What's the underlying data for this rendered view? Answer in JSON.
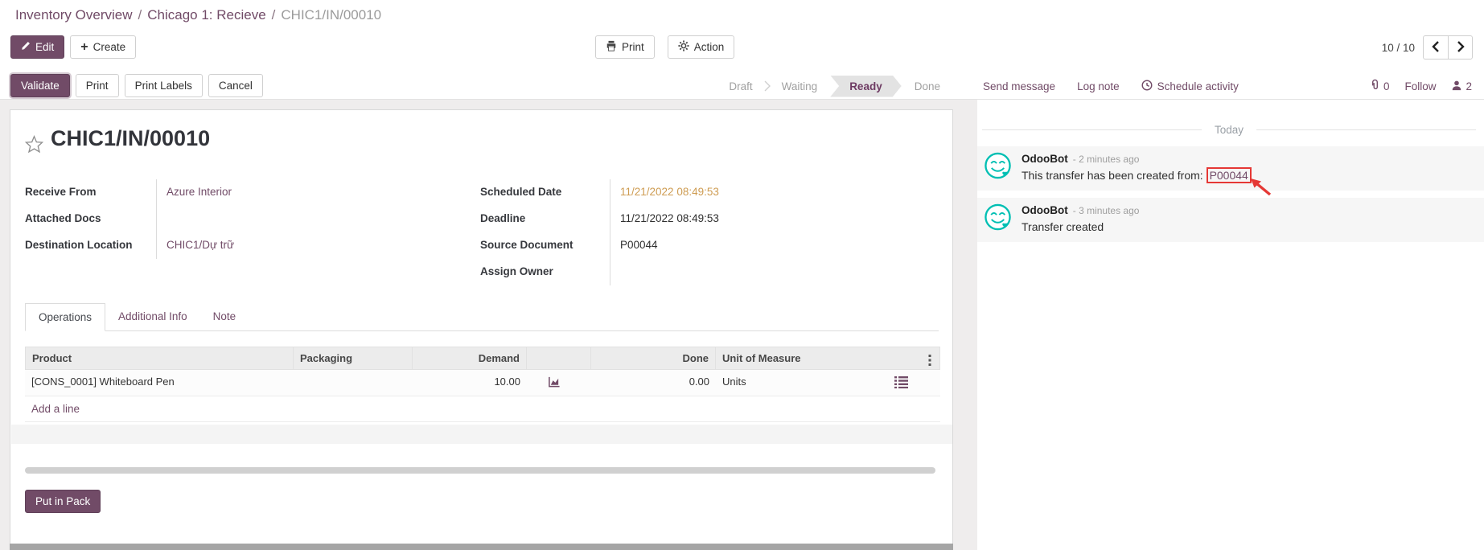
{
  "breadcrumb": {
    "part1": "Inventory Overview",
    "sep1": "/",
    "part2": "Chicago 1: Recieve",
    "sep2": "/",
    "part3": "CHIC1/IN/00010"
  },
  "control_panel": {
    "edit_label": "Edit",
    "create_label": "Create",
    "print_label": "Print",
    "action_label": "Action",
    "pager_counter": "10 / 10"
  },
  "statusbar": {
    "validate_label": "Validate",
    "print_label": "Print",
    "print_labels_label": "Print Labels",
    "cancel_label": "Cancel",
    "steps": {
      "draft": "Draft",
      "waiting": "Waiting",
      "ready": "Ready",
      "done": "Done"
    },
    "active_step": "Ready"
  },
  "chatter": {
    "send_message_label": "Send message",
    "log_note_label": "Log note",
    "schedule_activity_label": "Schedule activity",
    "attachment_count": "0",
    "follow_label": "Follow",
    "follower_count": "2",
    "date_divider": "Today",
    "messages": [
      {
        "author": "OdooBot",
        "time": "- 2 minutes ago",
        "body_prefix": "This transfer has been created from: ",
        "body_link": "P00044"
      },
      {
        "author": "OdooBot",
        "time": "- 3 minutes ago",
        "body": "Transfer created"
      }
    ]
  },
  "sheet": {
    "title": "CHIC1/IN/00010",
    "fields_left": [
      {
        "label": "Receive From",
        "value": "Azure Interior"
      },
      {
        "label": "Attached Docs",
        "value": ""
      },
      {
        "label": "Destination Location",
        "value": "CHIC1/Dự trữ"
      }
    ],
    "fields_right": [
      {
        "label": "Scheduled Date",
        "value": "11/21/2022 08:49:53"
      },
      {
        "label": "Deadline",
        "value": "11/21/2022 08:49:53"
      },
      {
        "label": "Source Document",
        "value": "P00044"
      },
      {
        "label": "Assign Owner",
        "value": ""
      }
    ],
    "tabs": {
      "operations": "Operations",
      "additional_info": "Additional Info",
      "note": "Note"
    },
    "active_tab": "Operations",
    "table": {
      "headers": {
        "product": "Product",
        "packaging": "Packaging",
        "demand": "Demand",
        "done": "Done",
        "uom": "Unit of Measure"
      },
      "rows": [
        {
          "product": "[CONS_0001] Whiteboard Pen",
          "packaging": "",
          "demand": "10.00",
          "done": "0.00",
          "uom": "Units"
        }
      ],
      "add_line_label": "Add a line"
    },
    "put_in_pack_label": "Put in Pack"
  },
  "icons": {
    "plus": "+"
  },
  "colors": {
    "primary": "#714B67",
    "link": "#714B67",
    "scheduled_date": "#ce9c52",
    "avatar_teal": "#00bfb3",
    "annotation_red": "#e53835"
  }
}
